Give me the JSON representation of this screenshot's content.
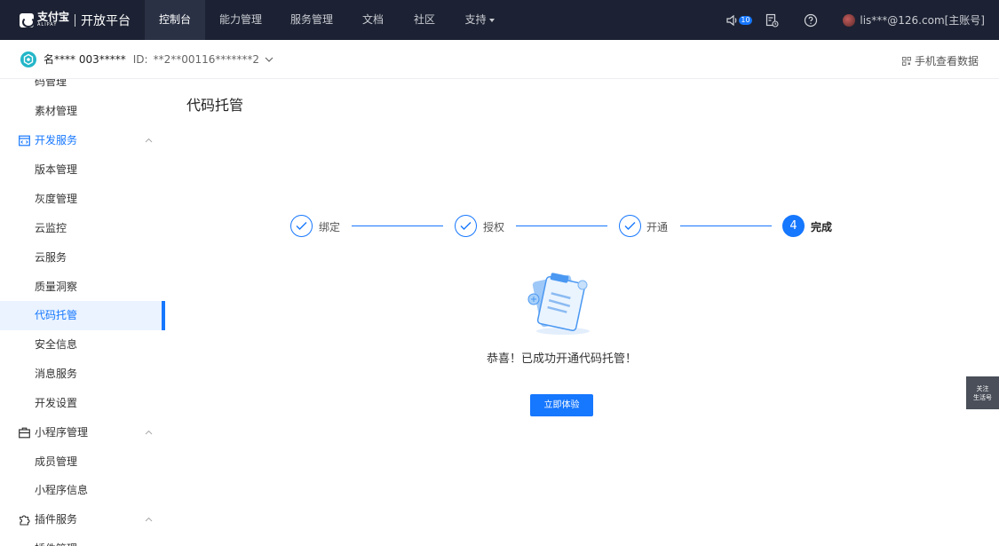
{
  "topnav": {
    "logo_cn": "支付宝",
    "logo_en": "ALIPAY",
    "platform": "开放平台",
    "items": [
      "控制台",
      "能力管理",
      "服务管理",
      "文档",
      "社区",
      "支持"
    ],
    "notification_count": "10",
    "user": "lis***@126.com[主账号]"
  },
  "subbar": {
    "app_name": "名**** 003*****",
    "app_id_label": "ID:",
    "app_id": "**2**00116*******2",
    "mobile_data": "手机查看数据"
  },
  "sidebar": {
    "items": [
      {
        "label": "码管理",
        "type": "child"
      },
      {
        "label": "素材管理",
        "type": "child"
      },
      {
        "label": "开发服务",
        "type": "group"
      },
      {
        "label": "版本管理",
        "type": "child"
      },
      {
        "label": "灰度管理",
        "type": "child"
      },
      {
        "label": "云监控",
        "type": "child"
      },
      {
        "label": "云服务",
        "type": "child"
      },
      {
        "label": "质量洞察",
        "type": "child"
      },
      {
        "label": "代码托管",
        "type": "child",
        "active": true
      },
      {
        "label": "安全信息",
        "type": "child"
      },
      {
        "label": "消息服务",
        "type": "child"
      },
      {
        "label": "开发设置",
        "type": "child"
      },
      {
        "label": "小程序管理",
        "type": "group"
      },
      {
        "label": "成员管理",
        "type": "child"
      },
      {
        "label": "小程序信息",
        "type": "child"
      },
      {
        "label": "插件服务",
        "type": "group"
      },
      {
        "label": "插件管理",
        "type": "child"
      }
    ]
  },
  "main": {
    "title": "代码托管",
    "steps": [
      {
        "label": "绑定",
        "status": "done"
      },
      {
        "label": "授权",
        "status": "done"
      },
      {
        "label": "开通",
        "status": "done"
      },
      {
        "label": "完成",
        "status": "current",
        "number": "4"
      }
    ],
    "success_message": "恭喜！已成功开通代码托管！",
    "cta_label": "立即体验"
  },
  "float_tab": {
    "line1": "关注",
    "line2": "生活号"
  },
  "colors": {
    "accent": "#1677ff",
    "topnav_bg": "#1c2233",
    "active_bg": "#eaf3ff"
  }
}
